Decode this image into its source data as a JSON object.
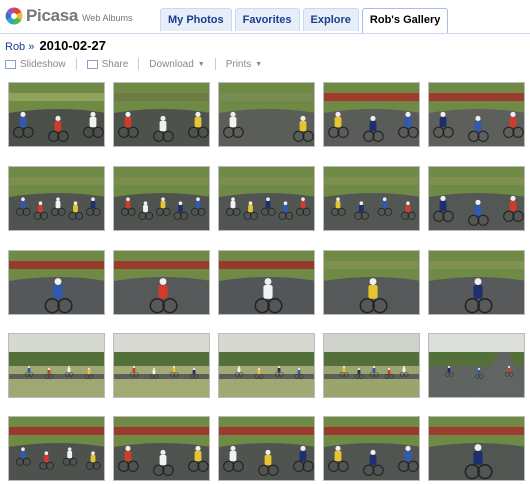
{
  "app": {
    "logo_name": "Picasa",
    "logo_sub": "Web Albums"
  },
  "tabs": [
    {
      "label": "My Photos"
    },
    {
      "label": "Favorites"
    },
    {
      "label": "Explore"
    },
    {
      "label": "Rob's Gallery",
      "active": true
    }
  ],
  "breadcrumb": {
    "user": "Rob",
    "separator": "»",
    "album_title": "2010-02-27"
  },
  "toolbar": {
    "slideshow": "Slideshow",
    "share": "Share",
    "download": "Download",
    "prints": "Prints"
  },
  "photos": [
    {
      "scene": "road-group",
      "sky": "#8fa35a",
      "road": "#4b4f4a",
      "riders": 3
    },
    {
      "scene": "road-group",
      "sky": "#6c7c44",
      "road": "#4e524c",
      "riders": 3
    },
    {
      "scene": "road-far",
      "sky": "#778c54",
      "road": "#5a5d58",
      "riders": 2
    },
    {
      "scene": "road-group",
      "sky": "#a03b2e",
      "road": "#595c58",
      "riders": 3
    },
    {
      "scene": "road-group",
      "sky": "#9c3b2f",
      "road": "#5d5f5b",
      "riders": 3
    },
    {
      "scene": "road-pack",
      "sky": "#7d8f4f",
      "road": "#505450",
      "riders": 5
    },
    {
      "scene": "road-pack",
      "sky": "#7a8c4e",
      "road": "#4f534f",
      "riders": 5
    },
    {
      "scene": "road-pack",
      "sky": "#7b8d50",
      "road": "#515551",
      "riders": 5
    },
    {
      "scene": "road-pack",
      "sky": "#7c8e50",
      "road": "#535753",
      "riders": 4
    },
    {
      "scene": "road-pack",
      "sky": "#7f9052",
      "road": "#545854",
      "riders": 3
    },
    {
      "scene": "road-solo",
      "sky": "#9a3a2e",
      "road": "#55585a",
      "riders": 1
    },
    {
      "scene": "road-solo",
      "sky": "#9b3b2e",
      "road": "#56595a",
      "riders": 1
    },
    {
      "scene": "road-solo",
      "sky": "#98392e",
      "road": "#535658",
      "riders": 1
    },
    {
      "scene": "road-solo",
      "sky": "#7e8f52",
      "road": "#56595a",
      "riders": 1
    },
    {
      "scene": "road-solo",
      "sky": "#7f9153",
      "road": "#57595b",
      "riders": 1
    },
    {
      "scene": "landscape",
      "sky": "#d6d8d2",
      "road": "#9fa872",
      "riders": 4
    },
    {
      "scene": "landscape",
      "sky": "#d8d9d3",
      "road": "#a2aa74",
      "riders": 4
    },
    {
      "scene": "landscape",
      "sky": "#d7d8d2",
      "road": "#a0a873",
      "riders": 4
    },
    {
      "scene": "landscape",
      "sky": "#cfd2cb",
      "road": "#9aa56e",
      "riders": 5
    },
    {
      "scene": "landscape-hill",
      "sky": "#dcdeda",
      "road": "#5f6460",
      "riders": 3
    },
    {
      "scene": "road-group",
      "sky": "#9a3a2e",
      "road": "#4e524e",
      "riders": 4
    },
    {
      "scene": "road-group",
      "sky": "#9b3b2f",
      "road": "#4f534f",
      "riders": 3
    },
    {
      "scene": "road-group",
      "sky": "#9c3c30",
      "road": "#505450",
      "riders": 3
    },
    {
      "scene": "road-group",
      "sky": "#9a3a2e",
      "road": "#515551",
      "riders": 3
    },
    {
      "scene": "road-solo",
      "sky": "#9d3c30",
      "road": "#525652",
      "riders": 1
    }
  ]
}
